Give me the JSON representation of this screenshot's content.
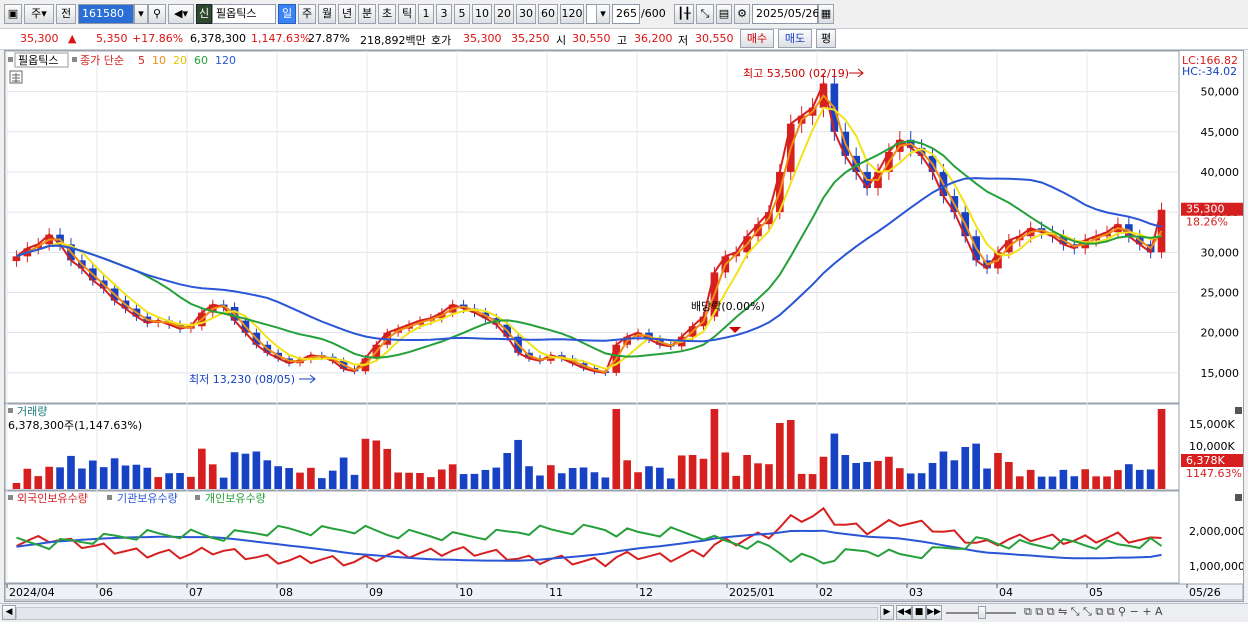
{
  "toolbar": {
    "period_sel": "주",
    "prev_label": "전",
    "code": "161580",
    "credit_badge": "신",
    "stock_name": "필옵틱스",
    "tabs": [
      "일",
      "주",
      "월",
      "년",
      "분",
      "초",
      "틱"
    ],
    "counts": [
      "1",
      "3",
      "5",
      "10",
      "20",
      "30",
      "60",
      "120"
    ],
    "bar_count": "265",
    "bar_total": "/600",
    "date": "2025/05/26"
  },
  "quote": {
    "price": "35,300",
    "arrow": "▲",
    "change": "5,350",
    "change_pct": "+17.86%",
    "volume": "6,378,300",
    "volume_pct": "1,147.63%",
    "turnover": "27.87%",
    "amount": "218,892백만",
    "ask_label": "호가",
    "ask": "35,300",
    "bid": "35,250",
    "open_label": "시",
    "open": "30,550",
    "high_label": "고",
    "high": "36,200",
    "low_label": "저",
    "low": "30,550",
    "buy_button": "매수",
    "sell_button": "매도",
    "eval_button": "평"
  },
  "chart_data": {
    "type": "candlestick",
    "legend": {
      "name": "필옵틱스",
      "ma_label": "종가 단순",
      "periods": [
        "5",
        "10",
        "20",
        "60",
        "120"
      ],
      "colors": [
        "#d62020",
        "#f08c12",
        "#f2e21a",
        "#25a03a",
        "#2a55d6"
      ]
    },
    "price_axis": {
      "ticks": [
        15000,
        20000,
        25000,
        30000,
        35000,
        40000,
        45000,
        50000
      ],
      "tick_labels": [
        "15,000",
        "20,000",
        "25,000",
        "30,000",
        "35,000",
        "40,000",
        "45,000",
        "50,000"
      ],
      "range": [
        11500,
        54800
      ],
      "lc_label": "LC:166.82",
      "hc_label": "HC:-34.02",
      "current_tag": "35,300",
      "current_pct": "18.26%",
      "current_value": 35300
    },
    "annotations": {
      "high_text": "최고 53,500 (02/19)",
      "high_value": 53500,
      "low_text": "최저 13,230 (08/05)",
      "low_value": 13230,
      "dividend_text": "배당락(0.00%)"
    },
    "x_labels": [
      "2024/04",
      "06",
      "07",
      "08",
      "09",
      "10",
      "11",
      "12",
      "2025/01",
      "02",
      "03",
      "04",
      "05",
      "05/26"
    ],
    "close_series": [
      29500,
      30500,
      31000,
      32200,
      31000,
      29000,
      28000,
      26500,
      25500,
      24000,
      23000,
      22000,
      21200,
      21500,
      21000,
      20500,
      20800,
      22500,
      23500,
      23200,
      21500,
      20000,
      18500,
      17500,
      16800,
      16200,
      16600,
      17200,
      17000,
      16500,
      15500,
      15200,
      16800,
      18500,
      20000,
      20500,
      21000,
      21500,
      21800,
      22500,
      23500,
      23000,
      22500,
      21800,
      21000,
      19500,
      17500,
      16800,
      16500,
      17200,
      16800,
      16200,
      15600,
      15200,
      15000,
      18500,
      19500,
      20000,
      19200,
      18500,
      18300,
      19500,
      20800,
      22000,
      27500,
      29500,
      30000,
      32000,
      33500,
      35000,
      40000,
      46000,
      47000,
      48000,
      51000,
      45000,
      42000,
      40000,
      38000,
      40000,
      42500,
      44000,
      43000,
      42000,
      40000,
      37000,
      35000,
      32000,
      29000,
      28000,
      30000,
      31500,
      32000,
      33000,
      32500,
      32000,
      31000,
      30500,
      31500,
      32000,
      32500,
      33500,
      32000,
      31000,
      30000,
      35300
    ],
    "volume_panel": {
      "title": "거래량",
      "value_text": "6,378,300주(1,147.63%)",
      "ticks": [
        "15,000K",
        "10,000K"
      ],
      "current_tag": "6,378K",
      "current_pct": "1147.63%"
    },
    "holdings_panel": {
      "series_names": [
        "외국인보유수량",
        "기관보유수량",
        "개인보유수량"
      ],
      "ticks": [
        "2,000,000",
        "1,000,000"
      ]
    }
  }
}
